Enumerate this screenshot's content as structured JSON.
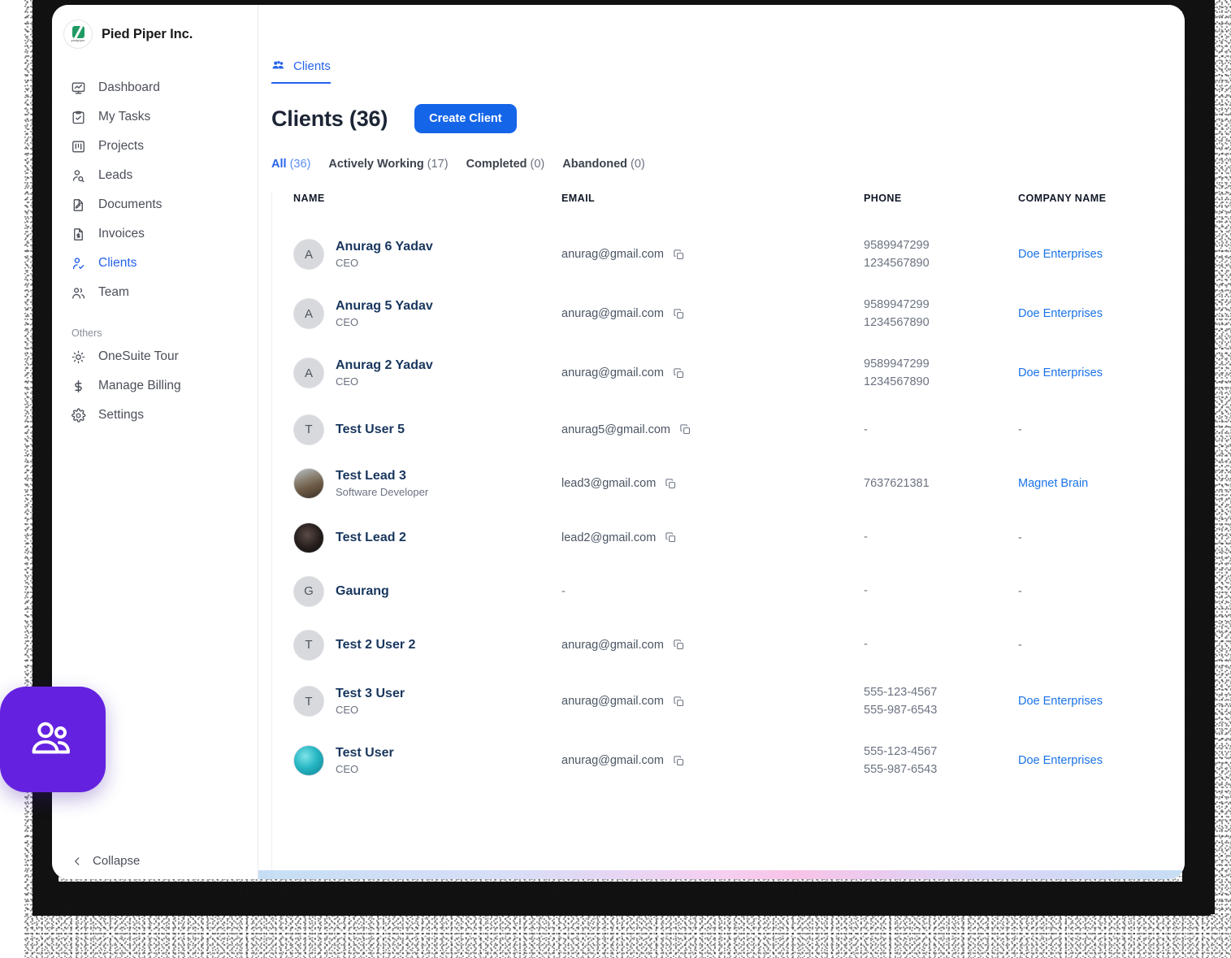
{
  "brand": {
    "name": "Pied Piper Inc.",
    "logo_wordmark": "piedpiper",
    "logo_color": "#1f9b63"
  },
  "sidebar": {
    "items": [
      {
        "label": "Dashboard",
        "icon": "monitor-chart-icon",
        "active": false
      },
      {
        "label": "My Tasks",
        "icon": "clipboard-check-icon",
        "active": false
      },
      {
        "label": "Projects",
        "icon": "kanban-board-icon",
        "active": false
      },
      {
        "label": "Leads",
        "icon": "user-search-icon",
        "active": false
      },
      {
        "label": "Documents",
        "icon": "document-edit-icon",
        "active": false
      },
      {
        "label": "Invoices",
        "icon": "invoice-dollar-icon",
        "active": false
      },
      {
        "label": "Clients",
        "icon": "user-check-icon",
        "active": true
      },
      {
        "label": "Team",
        "icon": "users-icon",
        "active": false
      }
    ],
    "section_label": "Others",
    "others": [
      {
        "label": "OneSuite Tour",
        "icon": "sun-tour-icon"
      },
      {
        "label": "Manage Billing",
        "icon": "dollar-icon"
      },
      {
        "label": "Settings",
        "icon": "gear-icon"
      }
    ],
    "collapse_label": "Collapse"
  },
  "tabs": [
    {
      "label": "Clients",
      "icon": "users-group-icon",
      "active": true
    }
  ],
  "page": {
    "title": "Clients (36)",
    "create_button": "Create Client",
    "accent_color": "#1565e8"
  },
  "filters": [
    {
      "label": "All",
      "count": "(36)",
      "active": true
    },
    {
      "label": "Actively Working",
      "count": "(17)",
      "active": false
    },
    {
      "label": "Completed",
      "count": "(0)",
      "active": false
    },
    {
      "label": "Abandoned",
      "count": "(0)",
      "active": false
    }
  ],
  "table": {
    "columns": [
      "NAME",
      "EMAIL",
      "PHONE",
      "COMPANY NAME"
    ],
    "rows": [
      {
        "avatar_type": "initial",
        "avatar_initial": "A",
        "name": "Anurag 6 Yadav",
        "role": "CEO",
        "email": "anurag@gmail.com",
        "phone1": "9589947299",
        "phone2": "1234567890",
        "company": "Doe Enterprises"
      },
      {
        "avatar_type": "initial",
        "avatar_initial": "A",
        "name": "Anurag 5 Yadav",
        "role": "CEO",
        "email": "anurag@gmail.com",
        "phone1": "9589947299",
        "phone2": "1234567890",
        "company": "Doe Enterprises"
      },
      {
        "avatar_type": "initial",
        "avatar_initial": "A",
        "name": "Anurag 2 Yadav",
        "role": "CEO",
        "email": "anurag@gmail.com",
        "phone1": "9589947299",
        "phone2": "1234567890",
        "company": "Doe Enterprises"
      },
      {
        "avatar_type": "initial",
        "avatar_initial": "T",
        "name": "Test User 5",
        "role": "",
        "email": "anurag5@gmail.com",
        "phone1": "-",
        "phone2": "",
        "company": "-"
      },
      {
        "avatar_type": "photo-a",
        "avatar_initial": "",
        "name": "Test Lead 3",
        "role": "Software Developer",
        "email": "lead3@gmail.com",
        "phone1": "7637621381",
        "phone2": "",
        "company": "Magnet Brain"
      },
      {
        "avatar_type": "photo-b",
        "avatar_initial": "",
        "name": "Test Lead 2",
        "role": "",
        "email": "lead2@gmail.com",
        "phone1": "-",
        "phone2": "",
        "company": "-"
      },
      {
        "avatar_type": "initial",
        "avatar_initial": "G",
        "name": "Gaurang",
        "role": "",
        "email": "-",
        "phone1": "-",
        "phone2": "",
        "company": "-"
      },
      {
        "avatar_type": "initial",
        "avatar_initial": "T",
        "name": "Test 2 User 2",
        "role": "",
        "email": "anurag@gmail.com",
        "phone1": "-",
        "phone2": "",
        "company": "-"
      },
      {
        "avatar_type": "initial",
        "avatar_initial": "T",
        "name": "Test 3 User",
        "role": "CEO",
        "email": "anurag@gmail.com",
        "phone1": "555-123-4567",
        "phone2": "555-987-6543",
        "company": "Doe Enterprises"
      },
      {
        "avatar_type": "photo-c",
        "avatar_initial": "",
        "name": "Test User",
        "role": "CEO",
        "email": "anurag@gmail.com",
        "phone1": "555-123-4567",
        "phone2": "555-987-6543",
        "company": "Doe Enterprises"
      }
    ]
  },
  "floating_widget": {
    "icon": "users-group-icon",
    "color": "#6422e0"
  }
}
